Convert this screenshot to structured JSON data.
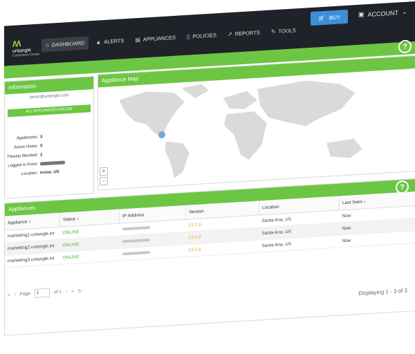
{
  "brand": {
    "name": "untangle",
    "subtitle": "Command Center"
  },
  "nav": [
    {
      "label": "DASHBOARD",
      "icon": "home-icon",
      "glyph": "⌂"
    },
    {
      "label": "ALERTS",
      "icon": "alert-icon",
      "glyph": "▲"
    },
    {
      "label": "APPLIANCES",
      "icon": "appliances-icon",
      "glyph": "▤"
    },
    {
      "label": "POLICIES",
      "icon": "policies-icon",
      "glyph": "▯"
    },
    {
      "label": "REPORTS",
      "icon": "reports-icon",
      "glyph": "↗"
    },
    {
      "label": "TOOLS",
      "icon": "tools-icon",
      "glyph": "✎"
    }
  ],
  "buy_label": "BUY",
  "account_label": "ACCOUNT",
  "info": {
    "title": "Information",
    "email": "demo@untangle.com",
    "online_label": "ALL APPLIANCES ONLINE",
    "rows": [
      {
        "k": "Appliances:",
        "v": "3"
      },
      {
        "k": "Active Hosts:",
        "v": "0"
      },
      {
        "k": "Threats Blocked:",
        "v": "2"
      },
      {
        "k": "Logged in From:",
        "v": ""
      },
      {
        "k": "Location:",
        "v": "Irvine, US"
      }
    ]
  },
  "map": {
    "title": "Appliance Map",
    "zoom_in": "+",
    "zoom_out": "-"
  },
  "appliances": {
    "title": "Appliances",
    "columns": [
      "Appliance ↕",
      "Status ↕",
      "IP Address",
      "Version",
      "Location",
      "Last Seen ↓"
    ],
    "rows": [
      {
        "appliance": "marketing1.untangle.int",
        "status": "ONLINE",
        "version": "13.2.0",
        "location": "Santa Ana, US",
        "last_seen": "Now"
      },
      {
        "appliance": "marketing2.untangle.int",
        "status": "ONLINE",
        "version": "13.2.0",
        "location": "Santa Ana, US",
        "last_seen": "Now"
      },
      {
        "appliance": "marketing3.untangle.int",
        "status": "ONLINE",
        "version": "13.2.0",
        "location": "Santa Ana, US",
        "last_seen": "Now"
      }
    ],
    "pager": {
      "first": "«",
      "prev": "‹",
      "page_label": "Page",
      "page": "1",
      "of": "of 1",
      "next": "›",
      "last": "»",
      "refresh": "↻"
    },
    "displaying": "Displaying 1 - 3 of 3"
  },
  "colors": {
    "accent_green": "#6cc644",
    "topbar": "#1f2329",
    "buy_blue": "#3c8fd8",
    "version_orange": "#f0a030"
  }
}
